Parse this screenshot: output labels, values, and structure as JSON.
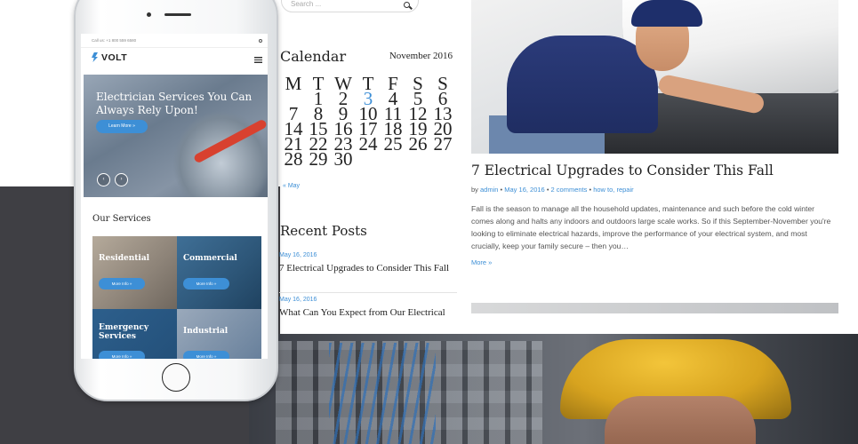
{
  "search": {
    "placeholder": "Search ..."
  },
  "calendar": {
    "title": "Calendar",
    "month": "November 2016",
    "weekdays": [
      "M",
      "T",
      "W",
      "T",
      "F",
      "S",
      "S"
    ],
    "weeks": [
      [
        "",
        "1",
        "2",
        "3",
        "4",
        "5",
        "6"
      ],
      [
        "7",
        "8",
        "9",
        "10",
        "11",
        "12",
        "13"
      ],
      [
        "14",
        "15",
        "16",
        "17",
        "18",
        "19",
        "20"
      ],
      [
        "21",
        "22",
        "23",
        "24",
        "25",
        "26",
        "27"
      ],
      [
        "28",
        "29",
        "30",
        "",
        "",
        "",
        ""
      ]
    ],
    "today": "3",
    "prev_link": "« May"
  },
  "recent_posts": {
    "title": "Recent Posts",
    "items": [
      {
        "date": "May 16, 2016",
        "title": "7 Electrical Upgrades to Consider This Fall"
      },
      {
        "date": "May 16, 2016",
        "title": "What Can You Expect from Our Electrical"
      }
    ]
  },
  "post": {
    "title": "7 Electrical Upgrades to Consider This Fall",
    "meta_by": "by",
    "author": "admin",
    "date": "May 16, 2016",
    "comments": "2 comments",
    "categories": "how to, repair",
    "excerpt": "Fall is the season to manage all the household updates, maintenance and such before the cold winter comes along and halts any indoors and outdoors large scale works. So if this September-November you're looking to eliminate electrical hazards, improve the performance of your electrical system, and most crucially, keep your family secure – then you…",
    "more": "More »"
  },
  "mobile": {
    "topbar_phone": "Call us: +1 800 559 6580",
    "logo": "VOLT",
    "hero_title": "Electrician Services You Can Always Rely Upon!",
    "hero_button": "Learn More »",
    "hero_prev": "‹",
    "hero_next": "›",
    "services_title": "Our Services",
    "services": [
      {
        "label": "Residential",
        "button": "More Info »"
      },
      {
        "label": "Commercial",
        "button": "More Info »"
      },
      {
        "label": "Emergency Services",
        "button": "More Info »"
      },
      {
        "label": "Industrial",
        "button": "More Info »"
      }
    ]
  },
  "colors": {
    "accent": "#3d8fd6",
    "dark_band": "#3f3f44"
  }
}
